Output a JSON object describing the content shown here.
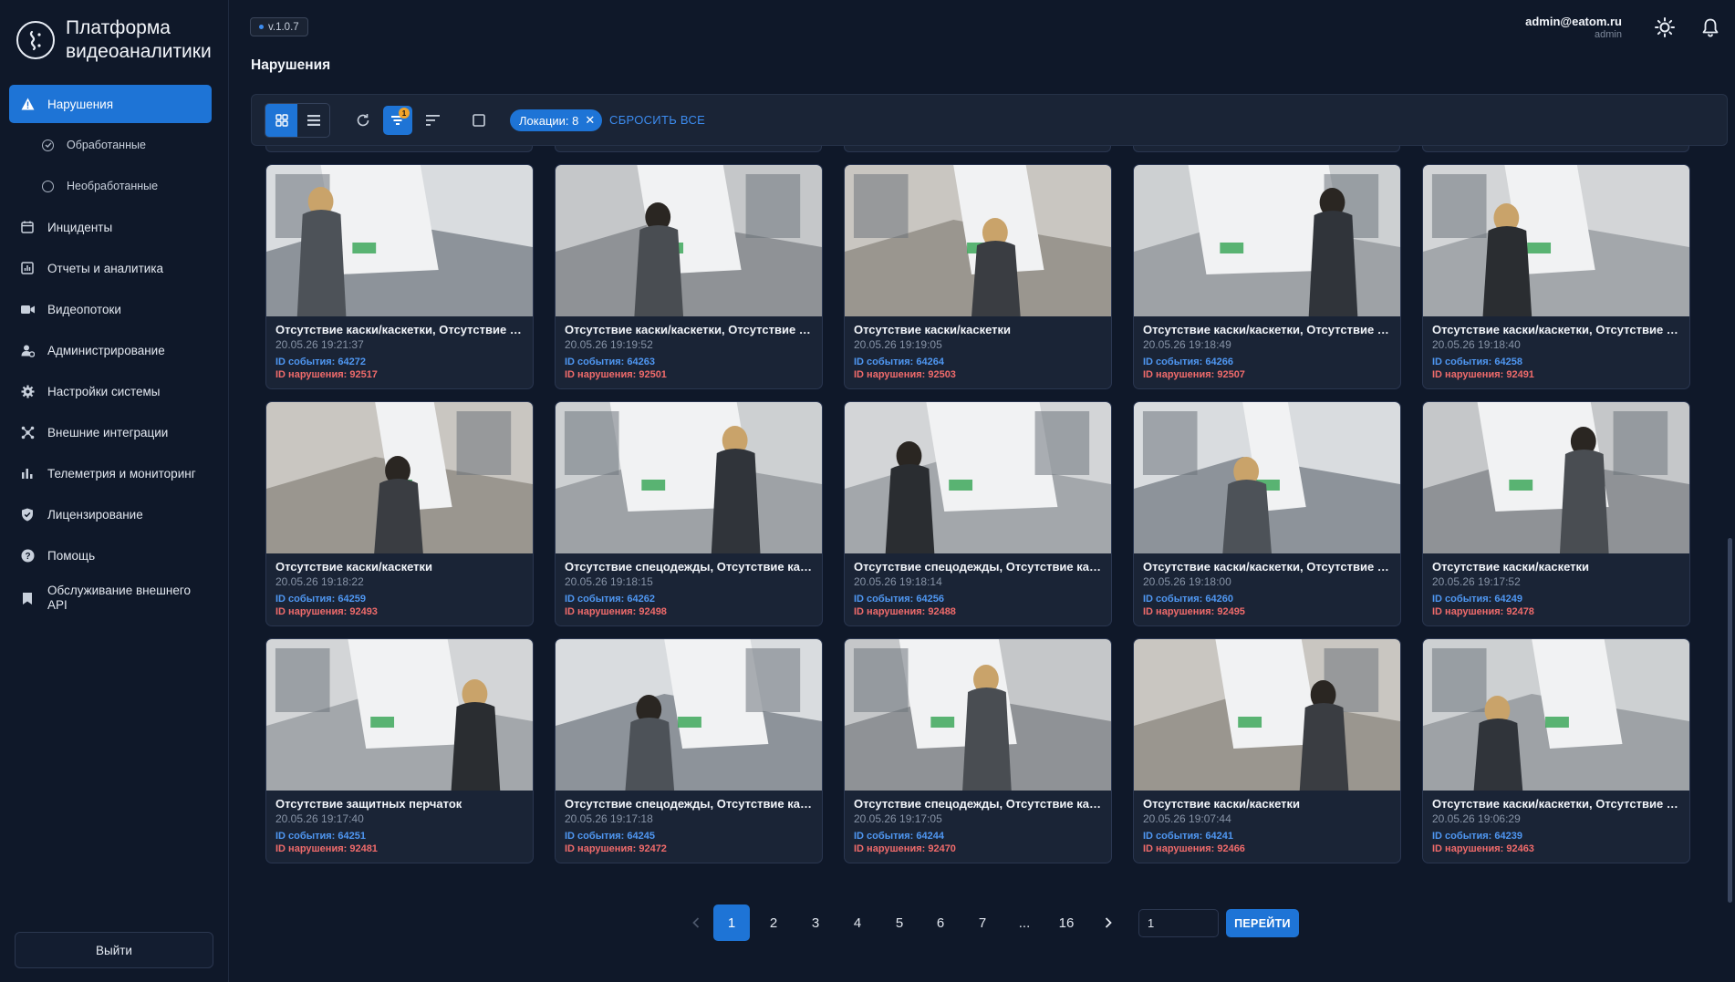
{
  "brand": {
    "title_line1": "Платформа",
    "title_line2": "видеоаналитики"
  },
  "version": "v.1.0.7",
  "page_title": "Нарушения",
  "user": {
    "email": "admin@eatom.ru",
    "role": "admin"
  },
  "sidebar": {
    "items": [
      {
        "label": "Нарушения",
        "icon": "warning-icon"
      },
      {
        "label": "Обработанные",
        "icon": "check-circle-icon"
      },
      {
        "label": "Необработанные",
        "icon": "circle-icon"
      },
      {
        "label": "Инциденты",
        "icon": "calendar-icon"
      },
      {
        "label": "Отчеты и аналитика",
        "icon": "chart-icon"
      },
      {
        "label": "Видеопотоки",
        "icon": "video-icon"
      },
      {
        "label": "Администрирование",
        "icon": "admin-icon"
      },
      {
        "label": "Настройки системы",
        "icon": "gear-icon"
      },
      {
        "label": "Внешние интеграции",
        "icon": "integration-icon"
      },
      {
        "label": "Телеметрия и мониторинг",
        "icon": "bars-icon"
      },
      {
        "label": "Лицензирование",
        "icon": "shield-icon"
      },
      {
        "label": "Помощь",
        "icon": "help-icon"
      },
      {
        "label": "Обслуживание внешнего API",
        "icon": "bookmark-icon"
      }
    ],
    "logout_label": "Выйти"
  },
  "toolbar": {
    "filter_badge": "1",
    "chip_label": "Локации: 8",
    "reset_label": "СБРОСИТЬ ВСЕ"
  },
  "cards": [
    {
      "title": "Отсутствие каски/каскетки, Отсутствие защитных перчаток",
      "time": "20.05.26 19:21:37",
      "event": "ID события: 64272",
      "violation": "ID нарушения: 92517"
    },
    {
      "title": "Отсутствие каски/каскетки, Отсутствие защитных перчаток",
      "time": "20.05.26 19:19:52",
      "event": "ID события: 64263",
      "violation": "ID нарушения: 92501"
    },
    {
      "title": "Отсутствие каски/каскетки",
      "time": "20.05.26 19:19:05",
      "event": "ID события: 64264",
      "violation": "ID нарушения: 92503"
    },
    {
      "title": "Отсутствие каски/каскетки, Отсутствие защитных перчаток",
      "time": "20.05.26 19:18:49",
      "event": "ID события: 64266",
      "violation": "ID нарушения: 92507"
    },
    {
      "title": "Отсутствие каски/каскетки, Отсутствие защитных перчаток",
      "time": "20.05.26 19:18:40",
      "event": "ID события: 64258",
      "violation": "ID нарушения: 92491"
    },
    {
      "title": "Отсутствие каски/каскетки",
      "time": "20.05.26 19:18:22",
      "event": "ID события: 64259",
      "violation": "ID нарушения: 92493"
    },
    {
      "title": "Отсутствие спецодежды, Отсутствие каски/каскетки",
      "time": "20.05.26 19:18:15",
      "event": "ID события: 64262",
      "violation": "ID нарушения: 92498"
    },
    {
      "title": "Отсутствие спецодежды, Отсутствие каски/каскетки",
      "time": "20.05.26 19:18:14",
      "event": "ID события: 64256",
      "violation": "ID нарушения: 92488"
    },
    {
      "title": "Отсутствие каски/каскетки, Отсутствие защитных перчаток",
      "time": "20.05.26 19:18:00",
      "event": "ID события: 64260",
      "violation": "ID нарушения: 92495"
    },
    {
      "title": "Отсутствие каски/каскетки",
      "time": "20.05.26 19:17:52",
      "event": "ID события: 64249",
      "violation": "ID нарушения: 92478"
    },
    {
      "title": "Отсутствие защитных перчаток",
      "time": "20.05.26 19:17:40",
      "event": "ID события: 64251",
      "violation": "ID нарушения: 92481"
    },
    {
      "title": "Отсутствие спецодежды, Отсутствие каски/каскетки",
      "time": "20.05.26 19:17:18",
      "event": "ID события: 64245",
      "violation": "ID нарушения: 92472"
    },
    {
      "title": "Отсутствие спецодежды, Отсутствие каски/каскетки",
      "time": "20.05.26 19:17:05",
      "event": "ID события: 64244",
      "violation": "ID нарушения: 92470"
    },
    {
      "title": "Отсутствие каски/каскетки",
      "time": "20.05.26 19:07:44",
      "event": "ID события: 64241",
      "violation": "ID нарушения: 92466"
    },
    {
      "title": "Отсутствие каски/каскетки, Отсутствие защитных перчаток",
      "time": "20.05.26 19:06:29",
      "event": "ID события: 64239",
      "violation": "ID нарушения: 92463"
    }
  ],
  "pagination": {
    "pages": [
      "1",
      "2",
      "3",
      "4",
      "5",
      "6",
      "7",
      "...",
      "16"
    ],
    "current": "1",
    "goto_value": "1",
    "goto_label": "ПЕРЕЙТИ"
  }
}
